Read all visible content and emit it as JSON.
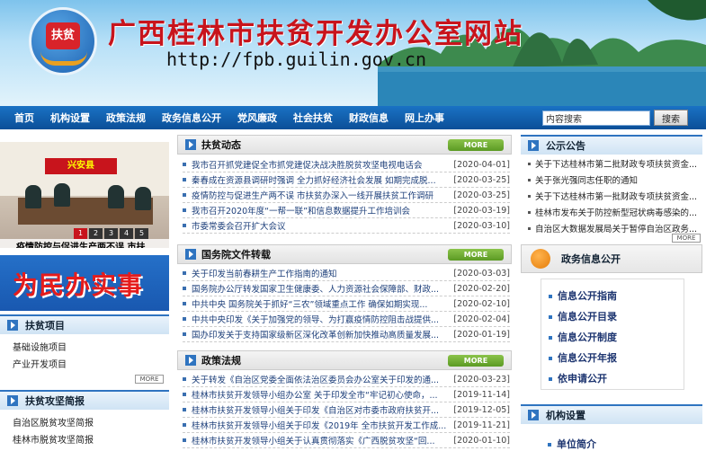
{
  "header": {
    "logo_text": "扶贫",
    "site_title": "广西桂林市扶贫开发办公室网站",
    "site_url": "http://fpb.guilin.gov.cn"
  },
  "nav": {
    "items": [
      "首页",
      "机构设置",
      "政策法规",
      "政务信息公开",
      "党风廉政",
      "社会扶贫",
      "财政信息",
      "网上办事"
    ],
    "search_placeholder": "内容搜索",
    "search_button": "搜索"
  },
  "slideshow": {
    "sign_text": "兴安县",
    "dots": [
      "1",
      "2",
      "3",
      "4",
      "5"
    ],
    "active_dot": 0,
    "caption": "疫情防控与促进生产两不误 市扶..."
  },
  "promo": {
    "text": "为民办实事"
  },
  "left_boxes": [
    {
      "title": "扶贫项目",
      "items": [
        "基础设施项目",
        "产业开发项目"
      ],
      "more": "MORE"
    },
    {
      "title": "扶贫攻坚简报",
      "items": [
        "自治区脱贫攻坚简报",
        "桂林市脱贫攻坚简报"
      ]
    }
  ],
  "middle_sections": [
    {
      "title": "扶贫动态",
      "more": "MORE",
      "rows": [
        {
          "title": "我市召开抓党建促全市抓党建促决战决胜脱贫攻坚电视电话会",
          "date": "[2020-04-01]"
        },
        {
          "title": "秦春成在资源县调研时强调 全力抓好经济社会发展 如期完成脱...",
          "date": "[2020-03-25]"
        },
        {
          "title": "疫情防控与促进生产两不误 市扶贫办深入一线开展扶贫工作调研",
          "date": "[2020-03-25]"
        },
        {
          "title": "我市召开2020年度“一帮一联”和信息数据提升工作培训会",
          "date": "[2020-03-19]"
        },
        {
          "title": "市委常委会召开扩大会议",
          "date": "[2020-03-10]"
        }
      ]
    },
    {
      "title": "国务院文件转载",
      "more": "MORE",
      "rows": [
        {
          "title": "关于印发当前春耕生产工作指南的通知",
          "date": "[2020-03-03]"
        },
        {
          "title": "国务院办公厅转发国家卫生健康委、人力资源社会保障部、财政...",
          "date": "[2020-02-20]"
        },
        {
          "title": "中共中央 国务院关于抓好“三农”领域重点工作 确保如期实现...",
          "date": "[2020-02-10]"
        },
        {
          "title": "中共中央印发《关于加强党的领导、为打赢疫情防控阻击战提供...",
          "date": "[2020-02-04]"
        },
        {
          "title": "国办印发关于支持国家级新区深化改革创新加快推动高质量发展...",
          "date": "[2020-01-19]"
        }
      ]
    },
    {
      "title": "政策法规",
      "more": "MORE",
      "rows": [
        {
          "title": "关于转发《自治区党委全面依法治区委员会办公室关于印发的通...",
          "date": "[2020-03-23]"
        },
        {
          "title": "桂林市扶贫开发领导小组办公室 关于印发全市“牢记初心使命，...",
          "date": "[2019-11-14]"
        },
        {
          "title": "桂林市扶贫开发领导小组关于印发《自治区对市委市政府扶贫开...",
          "date": "[2019-12-05]"
        },
        {
          "title": "桂林市扶贫开发领导小组关于印发《2019年 全市扶贫开发工作成...",
          "date": "[2019-11-21]"
        },
        {
          "title": "桂林市扶贫开发领导小组关于认真贯彻落实《广西脱贫攻坚“回...",
          "date": "[2020-01-10]"
        }
      ]
    }
  ],
  "notices": {
    "title": "公示公告",
    "rows": [
      "关于下达桂林市第二批财政专项扶贫资金...",
      "关于张光强同志任职的通知",
      "关于下达桂林市第一批财政专项扶贫资金...",
      "桂林市发布关于防控新型冠状病毒感染的...",
      "自治区大数据发展局关于暂停自治区政务..."
    ],
    "more": "MORE"
  },
  "gov_info": {
    "title": "政务信息公开",
    "items": [
      "信息公开指南",
      "信息公开目录",
      "信息公开制度",
      "信息公开年报",
      "依申请公开"
    ]
  },
  "org": {
    "title": "机构设置",
    "items": [
      "单位简介"
    ]
  }
}
